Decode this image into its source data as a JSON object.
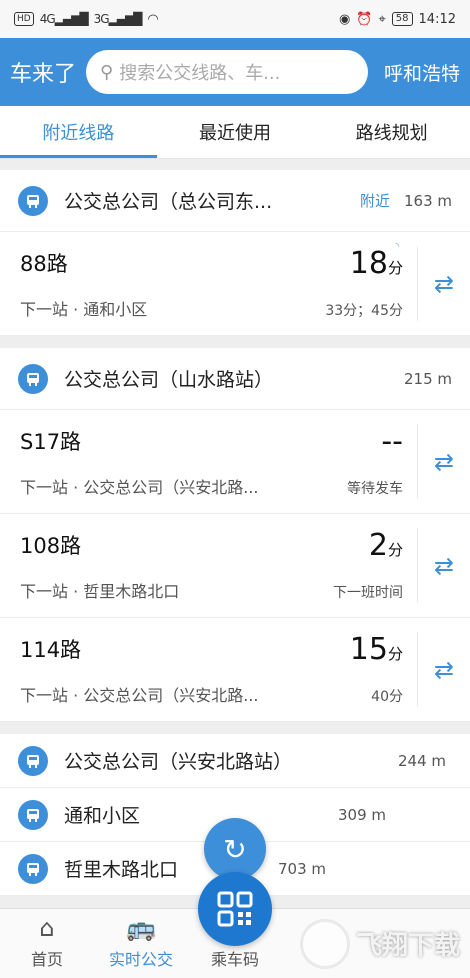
{
  "status_bar": {
    "left": [
      "HD",
      "4G",
      "3G"
    ],
    "battery": "58",
    "time": "14:12"
  },
  "header": {
    "title": "车来了",
    "search_placeholder": "搜索公交线路、车...",
    "city": "呼和浩特"
  },
  "tabs": [
    "附近线路",
    "最近使用",
    "路线规划"
  ],
  "stops": [
    {
      "name": "公交总公司（总公司东...",
      "tag": "附近",
      "distance": "163 m",
      "routes": [
        {
          "name": "88路",
          "next": "下一站 · 通和小区",
          "time": "18",
          "unit": "分",
          "sub": "33分；45分"
        }
      ]
    },
    {
      "name": "公交总公司（山水路站）",
      "distance": "215 m",
      "routes": [
        {
          "name": "S17路",
          "next": "下一站 · 公交总公司（兴安北路...",
          "time": "--",
          "unit": "",
          "sub": "等待发车"
        },
        {
          "name": "108路",
          "next": "下一站 · 哲里木路北口",
          "time": "2",
          "unit": "分",
          "sub": "下一班时间"
        },
        {
          "name": "114路",
          "next": "下一站 · 公交总公司（兴安北路...",
          "time": "15",
          "unit": "分",
          "sub": "40分"
        }
      ]
    }
  ],
  "nearby_stops": [
    {
      "name": "公交总公司（兴安北路站）",
      "distance": "244 m"
    },
    {
      "name": "通和小区",
      "distance": "309 m"
    },
    {
      "name": "哲里木路北口",
      "distance": "703 m"
    }
  ],
  "bottom_nav": [
    "首页",
    "实时公交",
    "乘车码"
  ],
  "watermark": "飞翔下载",
  "colors": {
    "accent": "#3d8fd9",
    "qr_button": "#1e78cf"
  }
}
